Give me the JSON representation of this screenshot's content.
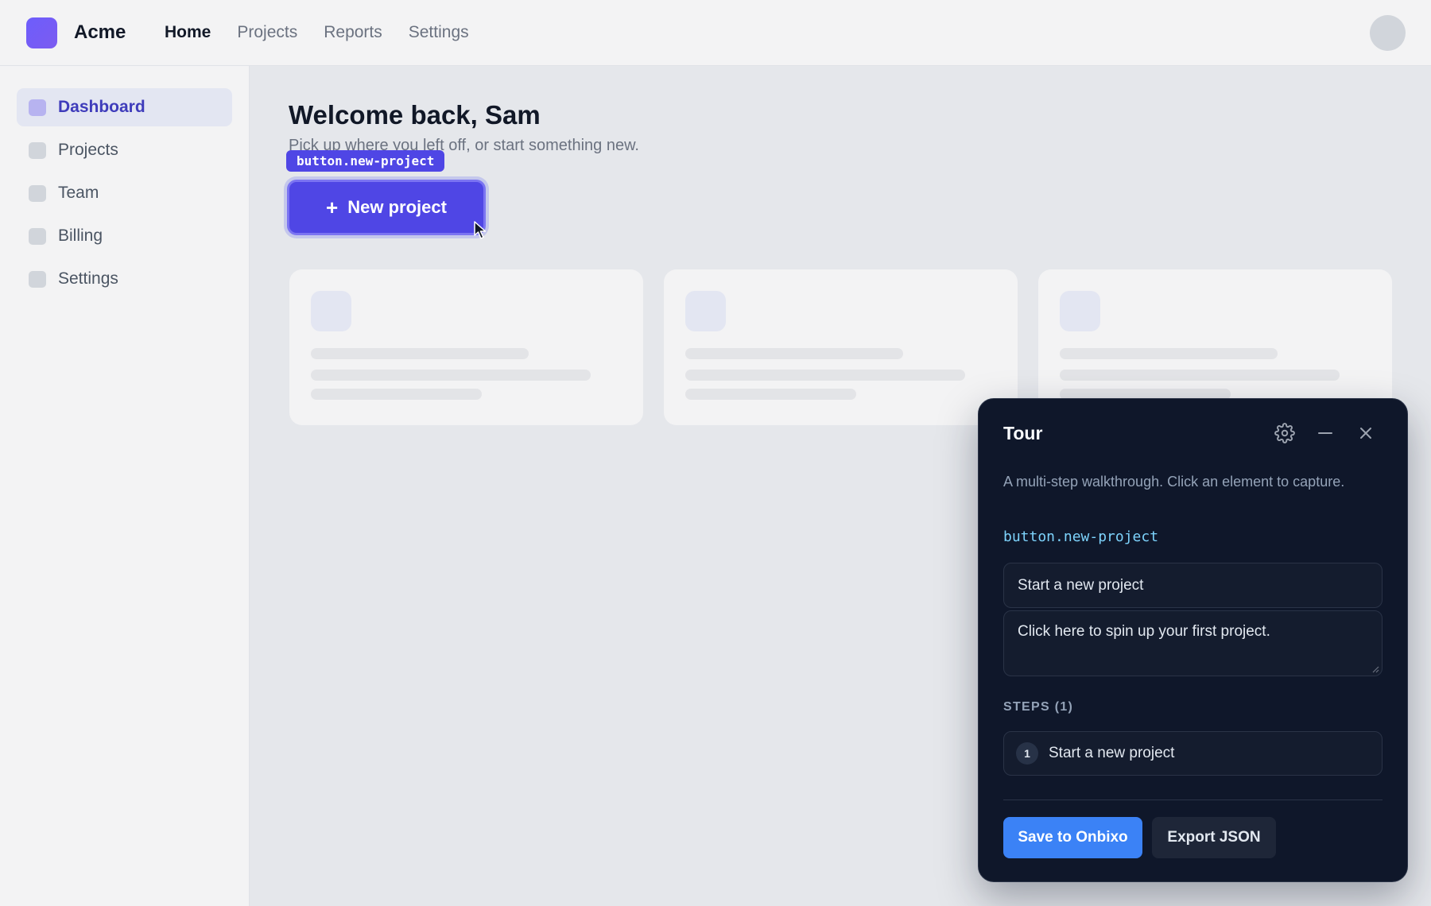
{
  "app": {
    "brand": "Acme"
  },
  "topnav": {
    "items": [
      "Home",
      "Projects",
      "Reports",
      "Settings"
    ],
    "active": "Home"
  },
  "sidebar": {
    "items": [
      {
        "label": "Dashboard",
        "active": true
      },
      {
        "label": "Projects"
      },
      {
        "label": "Team"
      },
      {
        "label": "Billing"
      },
      {
        "label": "Settings"
      }
    ]
  },
  "main": {
    "title": "Welcome back, Sam",
    "subtitle": "Pick up where you left off, or start something new.",
    "highlight_tag": "button.new-project",
    "new_project_label": "New project"
  },
  "tour": {
    "title": "Tour",
    "description": "A multi-step walkthrough. Click an element to capture.",
    "selector": "button.new-project",
    "step_title_value": "Start a new project",
    "step_body_value": "Click here to spin up your first project.",
    "steps_heading": "STEPS (1)",
    "steps": [
      {
        "number": "1",
        "title": "Start a new project"
      }
    ],
    "save_label": "Save to Onbixo",
    "export_label": "Export JSON"
  },
  "icons": {
    "logo": "logo-mark-icon",
    "settings": "gear-icon",
    "minimize": "minimize-icon",
    "close": "close-icon",
    "plus": "plus-icon",
    "cursor": "mouse-pointer-icon"
  },
  "colors": {
    "accent": "#4f46e5",
    "panel_bg": "#0f172a",
    "primary_button": "#3b82f6",
    "selector_text": "#7dd3fc"
  }
}
